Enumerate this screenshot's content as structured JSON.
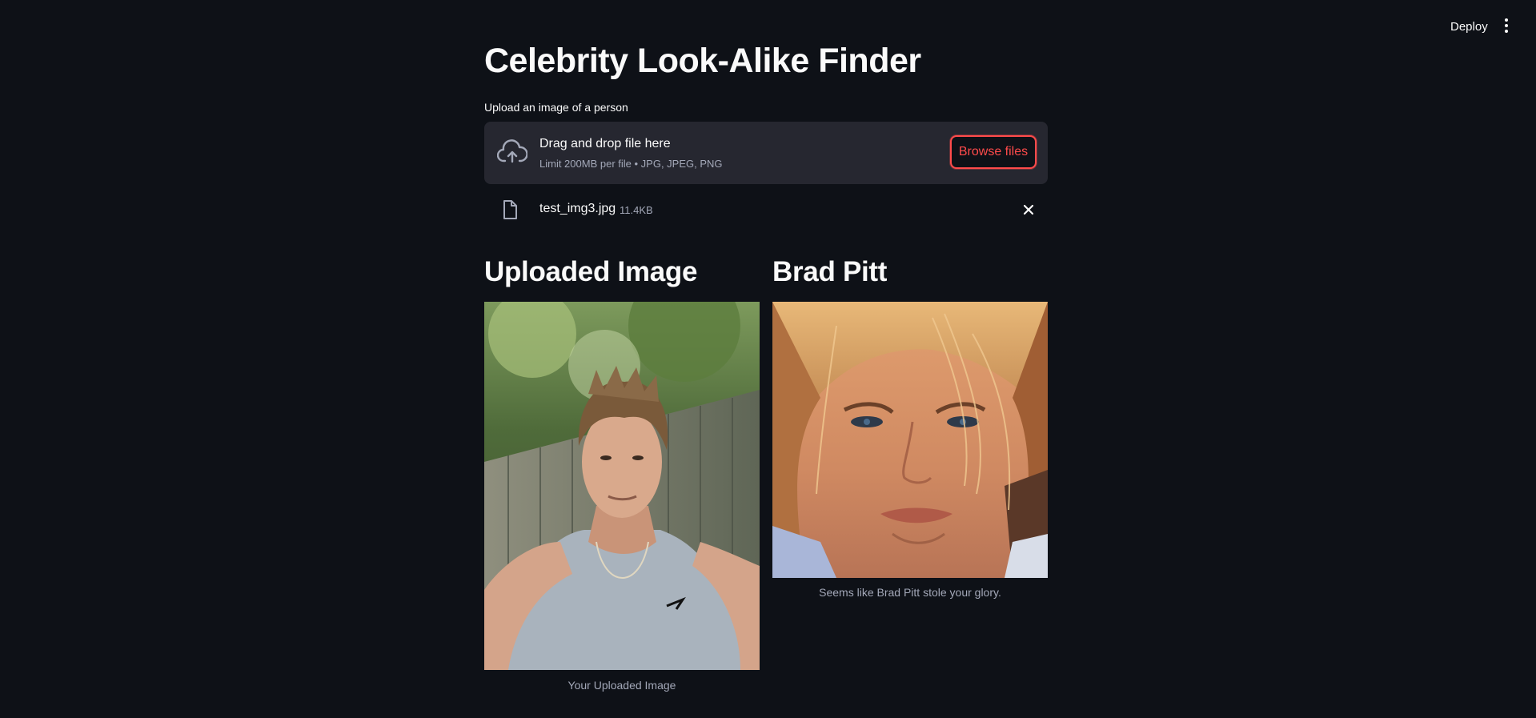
{
  "header": {
    "deploy_label": "Deploy",
    "menu_icon": "vertical-ellipsis-icon"
  },
  "page": {
    "title": "Celebrity Look-Alike Finder"
  },
  "uploader": {
    "label": "Upload an image of a person",
    "drop_title": "Drag and drop file here",
    "drop_subtitle": "Limit 200MB per file • JPG, JPEG, PNG",
    "browse_label": "Browse files",
    "icon": "cloud-upload-icon",
    "accent_color": "#ff4b4b"
  },
  "uploaded_file": {
    "name": "test_img3.jpg",
    "size": "11.4KB",
    "icon": "file-icon",
    "remove_icon": "close-icon"
  },
  "results": {
    "left": {
      "heading": "Uploaded Image",
      "caption": "Your Uploaded Image"
    },
    "right": {
      "heading": "Brad Pitt",
      "caption": "Seems like Brad Pitt stole your glory."
    }
  },
  "theme": {
    "background": "#0e1117",
    "surface": "#262730",
    "text": "#fafafa",
    "muted_text": "#a3a8b8"
  }
}
